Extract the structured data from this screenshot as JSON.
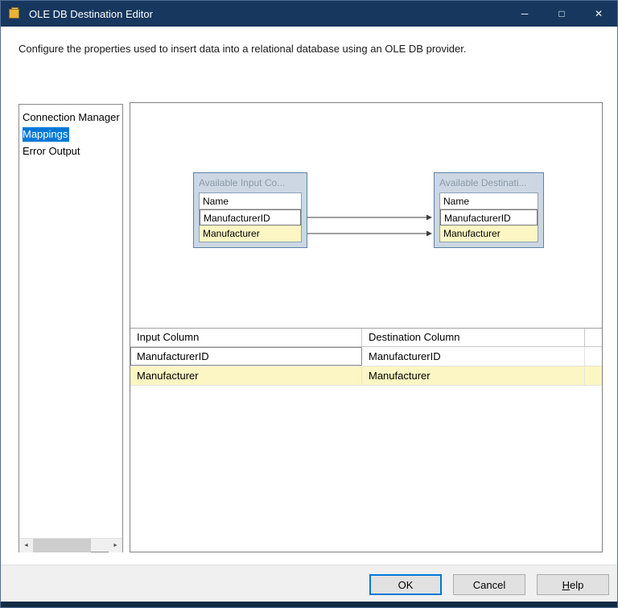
{
  "window": {
    "title": "OLE DB Destination Editor",
    "icons": {
      "minimize": "─",
      "maximize": "□",
      "close": "✕"
    }
  },
  "description": "Configure the properties used to insert data into a relational database using an OLE DB provider.",
  "sidebar": {
    "items": [
      {
        "label": "Connection Manager",
        "selected": false
      },
      {
        "label": "Mappings",
        "selected": true
      },
      {
        "label": "Error Output",
        "selected": false
      }
    ],
    "scrollbar": {
      "left_arrow": "◄",
      "right_arrow": "►"
    }
  },
  "diagram": {
    "source_table": {
      "title": "Available Input Co...",
      "header": "Name",
      "rows": [
        {
          "name": "ManufacturerID",
          "highlight": false
        },
        {
          "name": "Manufacturer",
          "highlight": true
        }
      ]
    },
    "destination_table": {
      "title": "Available Destinati...",
      "header": "Name",
      "rows": [
        {
          "name": "ManufacturerID",
          "highlight": false
        },
        {
          "name": "Manufacturer",
          "highlight": true
        }
      ]
    }
  },
  "grid": {
    "columns": [
      "Input Column",
      "Destination Column"
    ],
    "rows": [
      {
        "input": "ManufacturerID",
        "destination": "ManufacturerID",
        "highlight": false
      },
      {
        "input": "Manufacturer",
        "destination": "Manufacturer",
        "highlight": true
      }
    ]
  },
  "buttons": {
    "ok": "OK",
    "cancel": "Cancel",
    "help_first": "H",
    "help_rest": "elp"
  },
  "colors": {
    "titlebar": "#17375e",
    "accent": "#0078d7",
    "selection": "#0078d7",
    "row_highlight": "#fbf6c3",
    "entity_fill": "#ccd7e3",
    "entity_border": "#5b83a8"
  }
}
